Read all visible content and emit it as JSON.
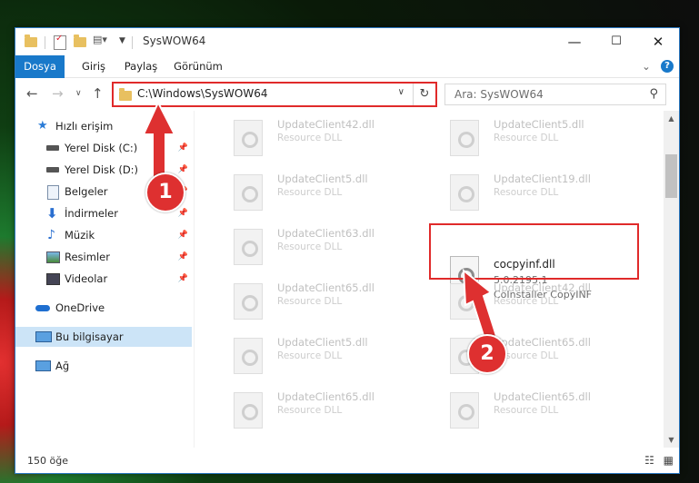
{
  "window": {
    "title": "SysWOW64",
    "minimize": "—",
    "maximize": "☐",
    "close": "✕"
  },
  "ribbon": {
    "tabs": [
      "Dosya",
      "Giriş",
      "Paylaş",
      "Görünüm"
    ],
    "expand": "⌄",
    "help": "?"
  },
  "address": {
    "path": "C:\\Windows\\SysWOW64",
    "search_placeholder": "Ara: SysWOW64"
  },
  "nav": {
    "quick_access": "Hızlı erişim",
    "items": [
      {
        "label": "Yerel Disk (C:)",
        "pinned": true,
        "icon": "drive-icon"
      },
      {
        "label": "Yerel Disk (D:)",
        "pinned": true,
        "icon": "drive-icon"
      },
      {
        "label": "Belgeler",
        "pinned": true,
        "icon": "documents-icon"
      },
      {
        "label": "İndirmeler",
        "pinned": true,
        "icon": "download-icon"
      },
      {
        "label": "Müzik",
        "pinned": true,
        "icon": "music-icon"
      },
      {
        "label": "Resimler",
        "pinned": true,
        "icon": "pictures-icon"
      },
      {
        "label": "Videolar",
        "pinned": true,
        "icon": "videos-icon"
      }
    ],
    "onedrive": "OneDrive",
    "this_pc": "Bu bilgisayar",
    "network": "Ağ"
  },
  "files": [
    {
      "name": "UpdateClient42.dll",
      "desc": "Resource DLL"
    },
    {
      "name": "UpdateClient5.dll",
      "desc": "Resource DLL"
    },
    {
      "name": "UpdateClient5.dll",
      "desc": "Resource DLL"
    },
    {
      "name": "UpdateClient19.dll",
      "desc": "Resource DLL"
    },
    {
      "name": "UpdateClient63.dll",
      "desc": "Resource DLL"
    },
    {
      "name": "UpdateClient65.dll",
      "desc": "Resource DLL"
    },
    {
      "name": "UpdateClient42.dll",
      "desc": "Resource DLL"
    },
    {
      "name": "UpdateClient5.dll",
      "desc": "Resource DLL"
    },
    {
      "name": "UpdateClient65.dll",
      "desc": "Resource DLL"
    },
    {
      "name": "UpdateClient65.dll",
      "desc": "Resource DLL"
    },
    {
      "name": "UpdateClient65.dll",
      "desc": "Resource DLL"
    }
  ],
  "highlighted_file": {
    "name": "cocpyinf.dll",
    "version": "5.0.2195.1",
    "desc": "CoInstaller CopyINF"
  },
  "status": {
    "count": "150 öğe"
  },
  "annotations": {
    "step1": "1",
    "step2": "2",
    "color": "#de3030"
  }
}
